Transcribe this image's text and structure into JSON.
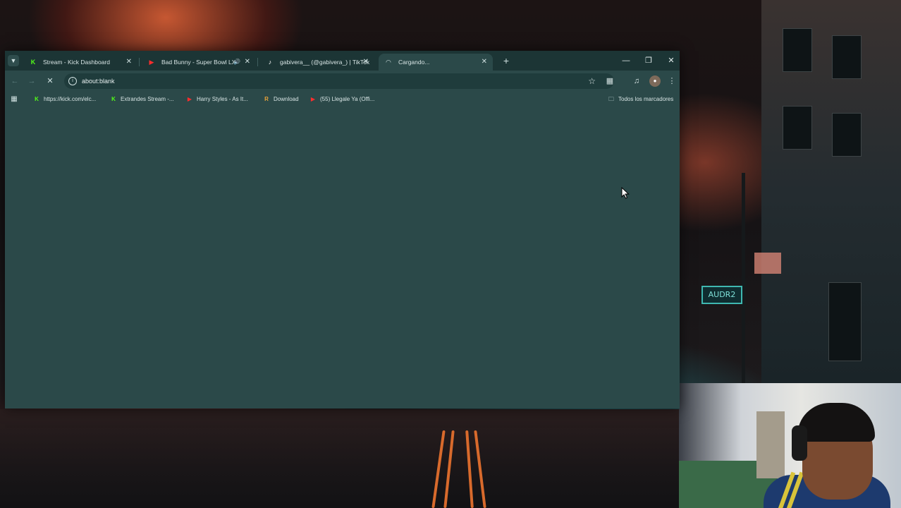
{
  "browser": {
    "tabs": [
      {
        "title": "Stream - Kick Dashboard",
        "favicon": "kick-logo-icon",
        "favicon_color": "#53fc18",
        "active": false
      },
      {
        "title": "Bad Bunny - Super Bowl LX",
        "favicon": "youtube-icon",
        "favicon_color": "#ff2d2d",
        "active": false,
        "playing_audio": true
      },
      {
        "title": "gabivera__ (@gabivera_) | TikTok",
        "favicon": "tiktok-icon",
        "favicon_color": "#ffffff",
        "active": false
      },
      {
        "title": "Cargando...",
        "favicon": "loading-spinner-icon",
        "favicon_color": "#cfe0e0",
        "active": true
      }
    ],
    "address_bar": {
      "url": "about:blank"
    },
    "bookmarks": [
      {
        "label": "https://kick.com/elc...",
        "favicon": "kick-logo-icon",
        "favicon_color": "#53fc18"
      },
      {
        "label": "Extrandes Stream -...",
        "favicon": "kick-logo-icon",
        "favicon_color": "#53fc18"
      },
      {
        "label": "Harry Styles - As It...",
        "favicon": "youtube-icon",
        "favicon_color": "#ff2d2d"
      },
      {
        "label": "Download",
        "favicon": "download-r-icon",
        "favicon_color": "#e8a33a"
      },
      {
        "label": "(55) Llegale Ya (Offi...",
        "favicon": "youtube-icon",
        "favicon_color": "#ff2d2d"
      }
    ],
    "all_bookmarks_label": "Todos los marcadores",
    "colors": {
      "frame": "#1c3535",
      "toolbar": "#2b4949",
      "omnibox": "#1f3c3c"
    }
  },
  "desktop": {
    "sign_text": "AUDR2"
  }
}
